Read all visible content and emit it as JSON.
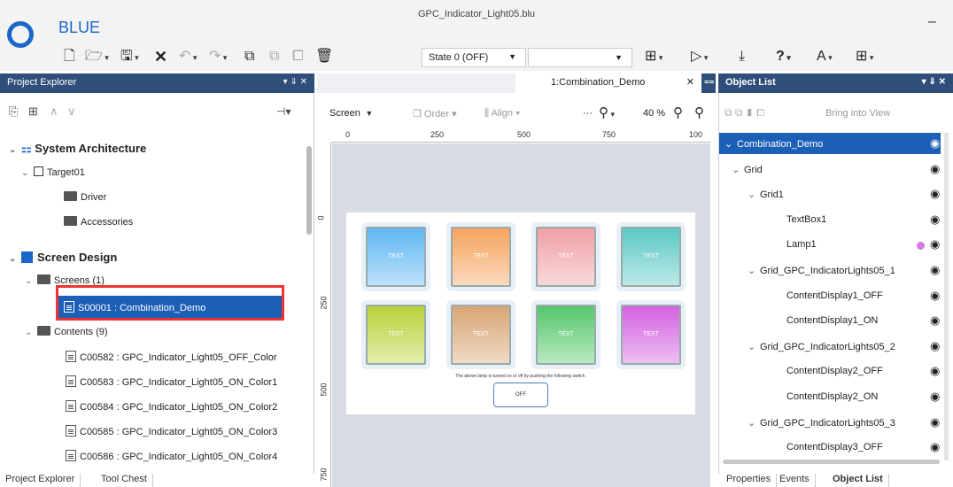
{
  "app": {
    "brand": "BLUE",
    "window_title": "GPC_Indicator_Light05.blu",
    "minimize": "–"
  },
  "toolbar": {
    "state_value": "State 0 (OFF)",
    "items": [
      "new-icon",
      "open-icon",
      "save-icon",
      "delete-icon",
      "undo-icon",
      "redo-icon",
      "copy-icon",
      "paste-icon",
      "duplicate-icon",
      "trash-icon"
    ]
  },
  "project_explorer": {
    "title": "Project Explorer",
    "pin_controls": "▾ ⇓ ✕",
    "tree": {
      "system_architecture": "System Architecture",
      "target": "Target01",
      "driver": "Driver",
      "accessories": "Accessories",
      "screen_design": "Screen Design",
      "screens": "Screens (1)",
      "screen_item": "S00001 : Combination_Demo",
      "contents": "Contents (9)",
      "content_items": [
        "C00582 : GPC_Indicator_Light05_OFF_Color",
        "C00583 : GPC_Indicator_Light05_ON_Color1",
        "C00584 : GPC_Indicator_Light05_ON_Color2",
        "C00585 : GPC_Indicator_Light05_ON_Color3",
        "C00586 : GPC_Indicator_Light05_ON_Color4"
      ]
    },
    "bottom_tabs": [
      "Project Explorer",
      "Tool Chest"
    ]
  },
  "editor": {
    "tab": "1:Combination_Demo",
    "toolbar": {
      "screen": "Screen",
      "order": "Order",
      "align": "Align",
      "zoom": "40 %"
    },
    "ruler_top": [
      "0",
      "250",
      "500",
      "750",
      "100"
    ],
    "ruler_left": [
      "0",
      "250",
      "500",
      "750"
    ],
    "lamps": [
      {
        "label": "TEXT",
        "color": "#5fb6f2"
      },
      {
        "label": "TEXT",
        "color": "#f5a35c"
      },
      {
        "label": "TEXT",
        "color": "#f0a0a5"
      },
      {
        "label": "TEXT",
        "color": "#5cc9c5"
      },
      {
        "label": "TEXT",
        "color": "#b8d23a"
      },
      {
        "label": "TEXT",
        "color": "#d9a574"
      },
      {
        "label": "TEXT",
        "color": "#55c76a"
      },
      {
        "label": "TEXT",
        "color": "#d462e0"
      }
    ],
    "caption": "The above lamp is turned on or off by pushing the following switch.",
    "switch_label": "OFF"
  },
  "object_list": {
    "title": "Object List",
    "toolbar_bring": "Bring into View",
    "rows": [
      {
        "label": "Combination_Demo",
        "arrow": "⌄"
      },
      {
        "label": "Grid",
        "arrow": "⌄"
      },
      {
        "label": "Grid1",
        "arrow": "⌄"
      },
      {
        "label": "TextBox1",
        "arrow": ""
      },
      {
        "label": "Lamp1",
        "arrow": ""
      },
      {
        "label": "Grid_GPC_IndicatorLights05_1",
        "arrow": "⌄"
      },
      {
        "label": "ContentDisplay1_OFF",
        "arrow": ""
      },
      {
        "label": "ContentDisplay1_ON",
        "arrow": ""
      },
      {
        "label": "Grid_GPC_IndicatorLights05_2",
        "arrow": "⌄"
      },
      {
        "label": "ContentDisplay2_OFF",
        "arrow": ""
      },
      {
        "label": "ContentDisplay2_ON",
        "arrow": ""
      },
      {
        "label": "Grid_GPC_IndicatorLights05_3",
        "arrow": "⌄"
      },
      {
        "label": "ContentDisplay3_OFF",
        "arrow": ""
      }
    ],
    "bottom_tabs": [
      "Properties",
      "Events",
      "Object List"
    ]
  }
}
